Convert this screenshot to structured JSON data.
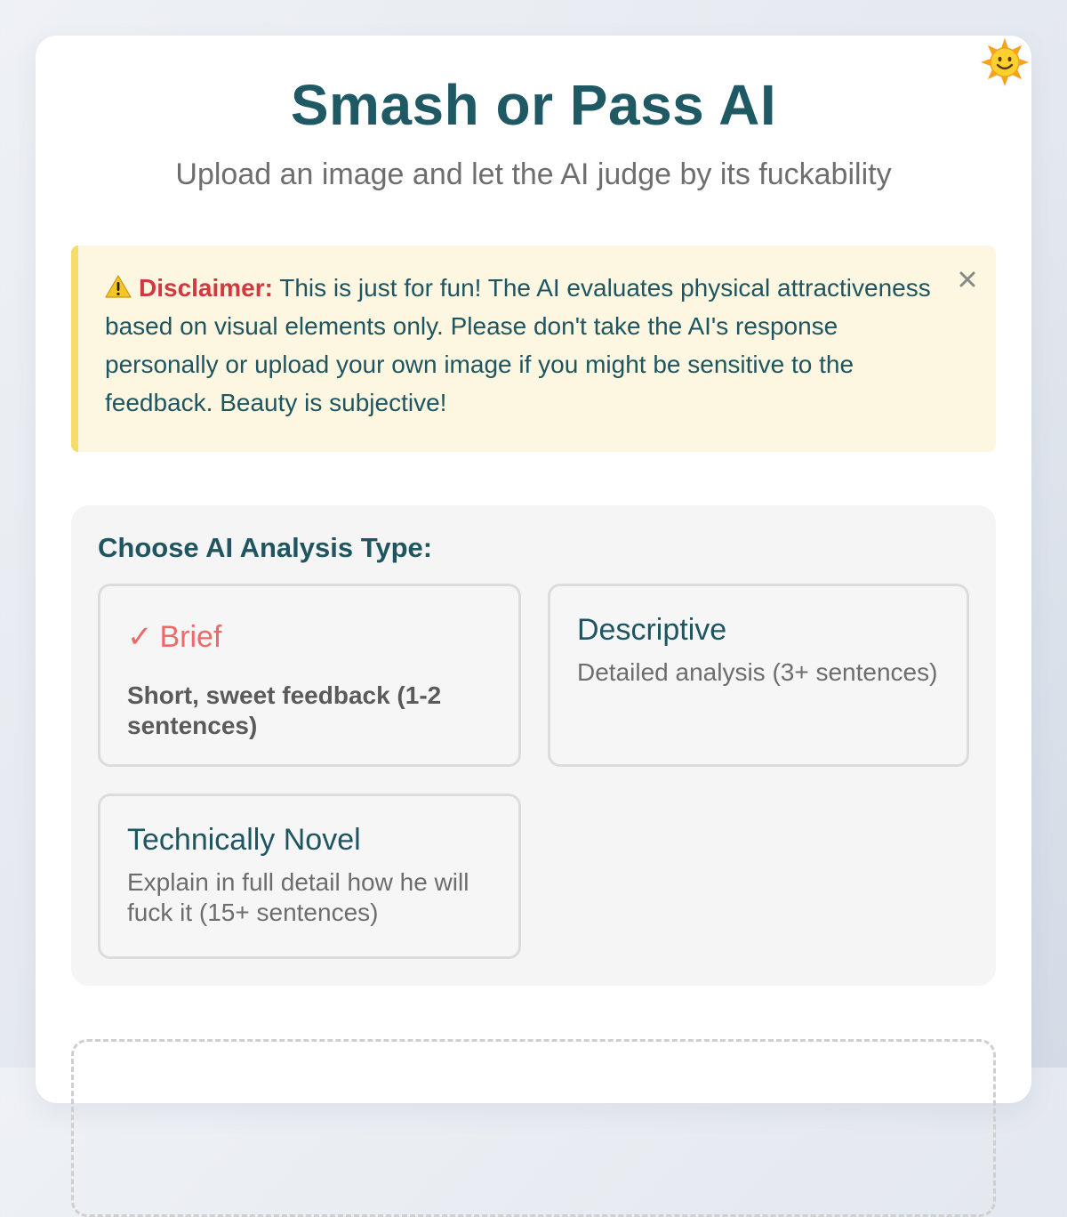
{
  "header": {
    "title": "Smash or Pass AI",
    "subtitle": "Upload an image and let the AI judge by its fuckability",
    "theme_icon": "sun-face-icon"
  },
  "disclaimer": {
    "icon": "warning-icon",
    "label": "Disclaimer:",
    "text": "This is just for fun! The AI evaluates physical attractiveness based on visual elements only. Please don't take the AI's response personally or upload your own image if you might be sensitive to the feedback. Beauty is subjective!",
    "close_icon": "close-icon"
  },
  "analysis": {
    "heading": "Choose AI Analysis Type:",
    "options": [
      {
        "title": "Brief",
        "description": "Short, sweet feedback (1-2 sentences)",
        "selected": true,
        "check": "✓"
      },
      {
        "title": "Descriptive",
        "description": "Detailed analysis (3+ sentences)",
        "selected": false
      },
      {
        "title": "Technically Novel",
        "description": "Explain in full detail how he will fuck it (15+ sentences)",
        "selected": false
      }
    ]
  },
  "colors": {
    "brand": "#1f5963",
    "selected_accent": "#ee6a6a",
    "disclaimer_label": "#d2383f",
    "disclaimer_bg": "#fdf7e2",
    "disclaimer_border": "#f6dc6a"
  }
}
